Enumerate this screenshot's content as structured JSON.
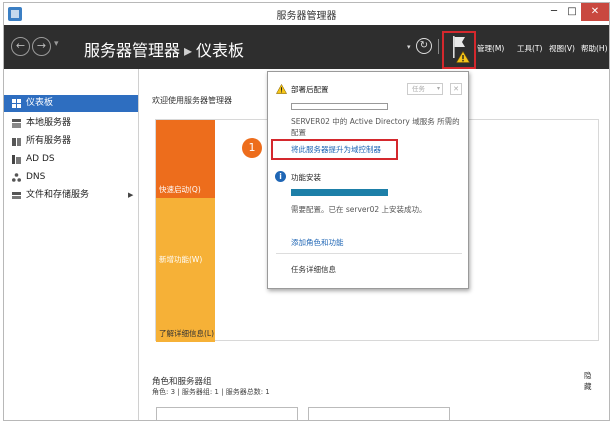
{
  "window": {
    "title": "服务器管理器",
    "min": "─",
    "max": "□",
    "close": "✕"
  },
  "header": {
    "back": "←",
    "forward": "→",
    "nav_dropdown": "▾",
    "breadcrumb_root": "服务器管理器",
    "breadcrumb_sep": "▸",
    "breadcrumb_page": "仪表板",
    "refresh_dropdown": "▾",
    "refresh": "↻",
    "menus": {
      "manage": "管理(M)",
      "tools": "工具(T)",
      "view": "视图(V)",
      "help": "帮助(H)"
    }
  },
  "sidebar": {
    "items": [
      {
        "label": "仪表板",
        "icon": "dashboard-icon"
      },
      {
        "label": "本地服务器",
        "icon": "local-server-icon"
      },
      {
        "label": "所有服务器",
        "icon": "all-servers-icon"
      },
      {
        "label": "AD DS",
        "icon": "ad-ds-icon"
      },
      {
        "label": "DNS",
        "icon": "dns-icon"
      },
      {
        "label": "文件和存储服务",
        "icon": "file-storage-icon"
      }
    ],
    "expand_arrow": "▶"
  },
  "main": {
    "welcome_title": "欢迎使用服务器管理器",
    "tiles": {
      "quickstart": "快速启动(Q)",
      "new": "新增功能(W)",
      "learn": "了解详细信息(L)"
    },
    "step_number": "1",
    "hide": "隐藏",
    "roles_title": "角色和服务器组",
    "roles_summary": "角色: 3 | 服务器组: 1 | 服务器总数: 1"
  },
  "notifications": {
    "deploy_title": "部署后配置",
    "task_button": "任务",
    "close": "✕",
    "deploy_message": "SERVER02 中的 Active Directory 域服务 所需的配置",
    "promote_link": "将此服务器提升为域控制器",
    "install_title": "功能安装",
    "install_progress": 1.0,
    "install_message": "需要配置。已在 server02 上安装成功。",
    "add_roles_link": "添加角色和功能",
    "task_details_link": "任务详细信息"
  },
  "colors": {
    "header_bg": "#2e2e2e",
    "active_item": "#2e6ec0",
    "orange_tile": "#ed6d1c",
    "yellow_tile": "#f6b137",
    "link_blue": "#1f66b5",
    "highlight_red": "#d4282d"
  }
}
